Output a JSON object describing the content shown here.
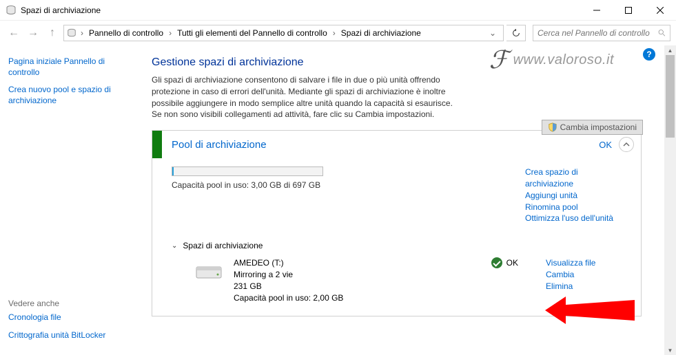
{
  "window": {
    "title": "Spazi di archiviazione"
  },
  "breadcrumb": {
    "items": [
      "Pannello di controllo",
      "Tutti gli elementi del Pannello di controllo",
      "Spazi di archiviazione"
    ]
  },
  "search": {
    "placeholder": "Cerca nel Pannello di controllo"
  },
  "sidebar": {
    "link1": "Pagina iniziale Pannello di controllo",
    "link2": "Crea nuovo pool e spazio di archiviazione",
    "see_also_title": "Vedere anche",
    "see_also_1": "Cronologia file",
    "see_also_2": "Crittografia unità BitLocker"
  },
  "page": {
    "title": "Gestione spazi di archiviazione",
    "desc": "Gli spazi di archiviazione consentono di salvare i file in due o più unità offrendo protezione in caso di errori dell'unità. Mediante gli spazi di archiviazione è inoltre possibile aggiungere in modo semplice altre unità quando la capacità si esaurisce. Se non sono visibili collegamenti ad attività, fare clic su Cambia impostazioni.",
    "change_btn": "Cambia impostazioni",
    "watermark": "www.valoroso.it"
  },
  "pool": {
    "title": "Pool di archiviazione",
    "status": "OK",
    "capacity_text": "Capacità pool in uso: 3,00 GB di 697 GB",
    "links": {
      "create": "Crea spazio di archiviazione",
      "add": "Aggiungi unità",
      "rename": "Rinomina pool",
      "optimize": "Ottimizza l'uso dell'unità"
    }
  },
  "spaces": {
    "header": "Spazi di archiviazione",
    "item": {
      "name": "AMEDEO (T:)",
      "type": "Mirroring a 2 vie",
      "size": "231 GB",
      "usage": "Capacità pool in uso: 2,00 GB",
      "status": "OK"
    },
    "links": {
      "view": "Visualizza file",
      "change": "Cambia",
      "delete": "Elimina"
    }
  }
}
